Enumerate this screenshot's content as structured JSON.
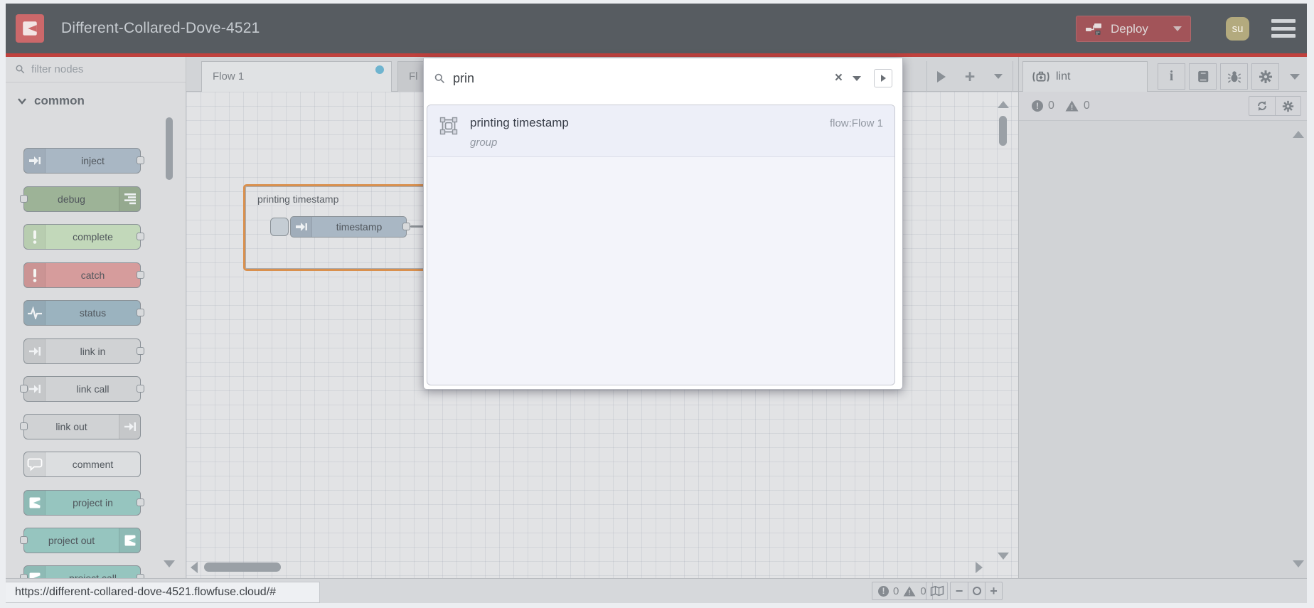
{
  "header": {
    "title": "Different-Collared-Dove-4521",
    "deploy_label": "Deploy",
    "avatar_initials": "su"
  },
  "palette": {
    "filter_placeholder": "filter nodes",
    "category_label": "common",
    "nodes": [
      {
        "label": "inject",
        "color": "#a9b7c4",
        "icon": "inject-arrow-icon",
        "icon_side": "left",
        "ports": [
          "right"
        ]
      },
      {
        "label": "debug",
        "color": "#9db397",
        "icon": "debug-lines-icon",
        "icon_side": "right",
        "ports": [
          "left"
        ]
      },
      {
        "label": "complete",
        "color": "#c2d8ba",
        "icon": "exclamation-icon",
        "icon_side": "left",
        "ports": [
          "right"
        ]
      },
      {
        "label": "catch",
        "color": "#d69c9c",
        "icon": "exclamation-icon",
        "icon_side": "left",
        "ports": [
          "right"
        ]
      },
      {
        "label": "status",
        "color": "#9bb3bf",
        "icon": "pulse-icon",
        "icon_side": "left",
        "ports": [
          "right"
        ]
      },
      {
        "label": "link in",
        "color": "#d0d2d4",
        "icon": "link-icon",
        "icon_side": "left",
        "ports": [
          "right"
        ]
      },
      {
        "label": "link call",
        "color": "#d0d2d4",
        "icon": "link-icon",
        "icon_side": "left",
        "ports": [
          "left",
          "right"
        ]
      },
      {
        "label": "link out",
        "color": "#d0d2d4",
        "icon": "link-icon",
        "icon_side": "right",
        "ports": [
          "left"
        ]
      },
      {
        "label": "comment",
        "color": "#dcdee0",
        "icon": "comment-bubble-icon",
        "icon_side": "left",
        "ports": []
      },
      {
        "label": "project in",
        "color": "#96c5bf",
        "icon": "project-logo-icon",
        "icon_side": "left",
        "ports": [
          "right"
        ]
      },
      {
        "label": "project out",
        "color": "#96c5bf",
        "icon": "project-logo-icon",
        "icon_side": "right",
        "ports": [
          "left"
        ]
      },
      {
        "label": "project call",
        "color": "#96c5bf",
        "icon": "project-logo-icon",
        "icon_side": "left",
        "ports": [
          "left",
          "right"
        ]
      }
    ]
  },
  "workspace": {
    "tabs": [
      {
        "label": "Flow 1",
        "active": true,
        "modified": true
      },
      {
        "label": "Fl",
        "active": false,
        "modified": false
      }
    ],
    "group_label": "printing timestamp",
    "node_label": "timestamp"
  },
  "search": {
    "query": "prin",
    "result": {
      "title": "printing timestamp",
      "type": "group",
      "location": "flow:Flow 1"
    }
  },
  "sidebar": {
    "tab_label": "lint",
    "error_count": "0",
    "warning_count": "0"
  },
  "footer": {
    "error_count": "0",
    "warning_count": "0"
  },
  "statusbar": {
    "url": "https://different-collared-dove-4521.flowfuse.cloud/#"
  },
  "colors": {
    "header_bg": "#575c61",
    "accent_red": "#c0413d",
    "deploy_bg": "#a25459",
    "group_selected": "#d9904e",
    "modified_dot": "#6fb4cf"
  }
}
